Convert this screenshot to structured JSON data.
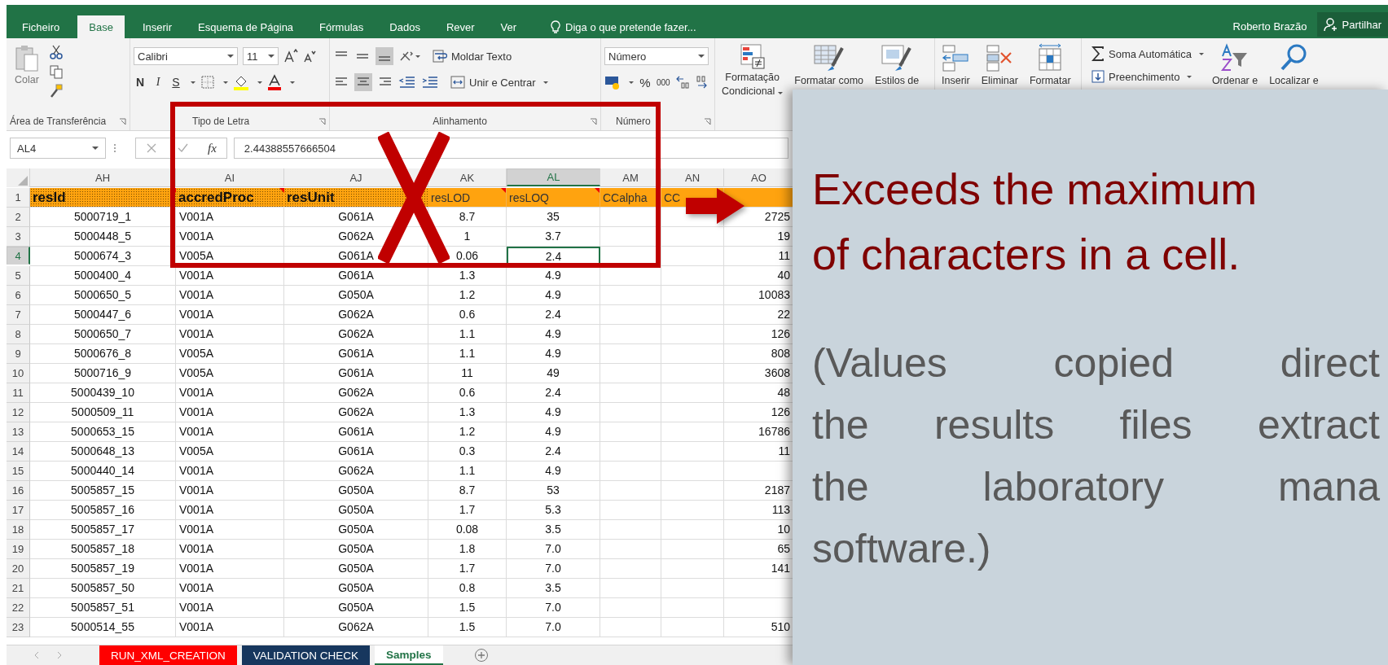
{
  "ribbon_tabs": [
    {
      "label": "Ficheiro",
      "selected": false
    },
    {
      "label": "Base",
      "selected": true
    },
    {
      "label": "Inserir",
      "selected": false
    },
    {
      "label": "Esquema de Página",
      "selected": false
    },
    {
      "label": "Fórmulas",
      "selected": false
    },
    {
      "label": "Dados",
      "selected": false
    },
    {
      "label": "Rever",
      "selected": false
    },
    {
      "label": "Ver",
      "selected": false
    }
  ],
  "tell_me": "Diga o que pretende fazer...",
  "user": "Roberto Brazão",
  "share_button": "Partilhar",
  "clipboard": {
    "paste": "Colar",
    "group": "Área de Transferência"
  },
  "font": {
    "family": "Calibri",
    "size": "11",
    "bold": "N",
    "italic": "I",
    "underline": "S",
    "group": "Tipo de Letra"
  },
  "alignment": {
    "wrap": "Moldar Texto",
    "merge": "Unir e Centrar",
    "group": "Alinhamento"
  },
  "number": {
    "format": "Número",
    "percent": "%",
    "thousands": "000",
    "group": "Número"
  },
  "styles": {
    "conditional": "Formatação",
    "conditional_2": "Condicional",
    "format_table": "Formatar como",
    "cell_styles": "Estilos de"
  },
  "cells_group": {
    "insert": "Inserir",
    "delete": "Eliminar",
    "format": "Formatar"
  },
  "editing": {
    "autosum": "Soma Automática",
    "fill": "Preenchimento",
    "sort": "Ordenar e",
    "find": "Localizar e"
  },
  "formula_bar": {
    "name_box": "AL4",
    "fx": "fx",
    "value": "2.44388557666504"
  },
  "columns": [
    {
      "label": "AH",
      "selected": false
    },
    {
      "label": "AI",
      "selected": false
    },
    {
      "label": "AJ",
      "selected": false
    },
    {
      "label": "AK",
      "selected": false
    },
    {
      "label": "AL",
      "selected": true
    },
    {
      "label": "AM",
      "selected": false
    },
    {
      "label": "AN",
      "selected": false
    },
    {
      "label": "AO",
      "selected": false
    }
  ],
  "header_row": {
    "number": "1",
    "cells": [
      {
        "text": "resId",
        "kind": "key",
        "comment": true
      },
      {
        "text": "accredProc",
        "kind": "key",
        "comment": true
      },
      {
        "text": "resUnit",
        "kind": "key",
        "comment": false
      },
      {
        "text": "resLOD",
        "kind": "plain",
        "comment": true
      },
      {
        "text": "resLOQ",
        "kind": "plain",
        "comment": true
      },
      {
        "text": "CCalpha",
        "kind": "plain",
        "comment": false
      },
      {
        "text": "CC",
        "kind": "plain",
        "comment": false
      },
      {
        "kind": "plain",
        "comment": false
      }
    ]
  },
  "rows": [
    {
      "number": "2",
      "selected": false,
      "cells": [
        "5000719_1",
        "V001A",
        "G061A",
        "8.7",
        "35",
        null,
        null,
        "2725"
      ]
    },
    {
      "number": "3",
      "selected": false,
      "cells": [
        "5000448_5",
        "V001A",
        "G062A",
        "1",
        "3.7",
        null,
        null,
        "19"
      ]
    },
    {
      "number": "4",
      "selected": true,
      "cells": [
        "5000674_3",
        "V005A",
        "G061A",
        "0.06",
        "2.4",
        null,
        null,
        "11"
      ]
    },
    {
      "number": "5",
      "selected": false,
      "cells": [
        "5000400_4",
        "V001A",
        "G061A",
        "1.3",
        "4.9",
        null,
        null,
        "40"
      ]
    },
    {
      "number": "6",
      "selected": false,
      "cells": [
        "5000650_5",
        "V001A",
        "G050A",
        "1.2",
        "4.9",
        null,
        null,
        "10083"
      ]
    },
    {
      "number": "7",
      "selected": false,
      "cells": [
        "5000447_6",
        "V001A",
        "G062A",
        "0.6",
        "2.4",
        null,
        null,
        "22"
      ]
    },
    {
      "number": "8",
      "selected": false,
      "cells": [
        "5000650_7",
        "V001A",
        "G062A",
        "1.1",
        "4.9",
        null,
        null,
        "126"
      ]
    },
    {
      "number": "9",
      "selected": false,
      "cells": [
        "5000676_8",
        "V005A",
        "G061A",
        "1.1",
        "4.9",
        null,
        null,
        "808"
      ]
    },
    {
      "number": "10",
      "selected": false,
      "cells": [
        "5000716_9",
        "V005A",
        "G061A",
        "11",
        "49",
        null,
        null,
        "3608"
      ]
    },
    {
      "number": "11",
      "selected": false,
      "cells": [
        "5000439_10",
        "V001A",
        "G062A",
        "0.6",
        "2.4",
        null,
        null,
        "48"
      ]
    },
    {
      "number": "12",
      "selected": false,
      "cells": [
        "5000509_11",
        "V001A",
        "G062A",
        "1.3",
        "4.9",
        null,
        null,
        "126"
      ]
    },
    {
      "number": "13",
      "selected": false,
      "cells": [
        "5000653_15",
        "V001A",
        "G061A",
        "1.2",
        "4.9",
        null,
        null,
        "16786"
      ]
    },
    {
      "number": "14",
      "selected": false,
      "cells": [
        "5000648_13",
        "V005A",
        "G061A",
        "0.3",
        "2.4",
        null,
        null,
        "11"
      ]
    },
    {
      "number": "15",
      "selected": false,
      "cells": [
        "5000440_14",
        "V001A",
        "G062A",
        "1.1",
        "4.9",
        null,
        null,
        null
      ]
    },
    {
      "number": "16",
      "selected": false,
      "cells": [
        "5005857_15",
        "V001A",
        "G050A",
        "8.7",
        "53",
        null,
        null,
        "2187"
      ]
    },
    {
      "number": "17",
      "selected": false,
      "cells": [
        "5005857_16",
        "V001A",
        "G050A",
        "1.7",
        "5.3",
        null,
        null,
        "113"
      ]
    },
    {
      "number": "18",
      "selected": false,
      "cells": [
        "5005857_17",
        "V001A",
        "G050A",
        "0.08",
        "3.5",
        null,
        null,
        "10"
      ]
    },
    {
      "number": "19",
      "selected": false,
      "cells": [
        "5005857_18",
        "V001A",
        "G050A",
        "1.8",
        "7.0",
        null,
        null,
        "65"
      ]
    },
    {
      "number": "20",
      "selected": false,
      "cells": [
        "5005857_19",
        "V001A",
        "G050A",
        "1.7",
        "7.0",
        null,
        null,
        "141"
      ]
    },
    {
      "number": "21",
      "selected": false,
      "cells": [
        "5005857_50",
        "V001A",
        "G050A",
        "0.8",
        "3.5",
        null,
        null,
        null
      ]
    },
    {
      "number": "22",
      "selected": false,
      "cells": [
        "5005857_51",
        "V001A",
        "G050A",
        "1.5",
        "7.0",
        null,
        null,
        null
      ]
    },
    {
      "number": "23",
      "selected": false,
      "cells": [
        "5000514_55",
        "V001A",
        "G062A",
        "1.5",
        "7.0",
        null,
        null,
        "510"
      ]
    }
  ],
  "sheet_tabs": [
    {
      "label": "RUN_XML_CREATION",
      "selected": false,
      "color": "#ff0000"
    },
    {
      "label": "VALIDATION CHECK",
      "selected": false,
      "color": "#17375e"
    },
    {
      "label": "Samples",
      "selected": true
    }
  ],
  "annotation": {
    "heading": [
      "Exceeds the maximum",
      "of characters in a cell."
    ],
    "paragraph": [
      "(Values copied direct",
      "the results files extract",
      "the laboratory mana",
      "software.)"
    ]
  }
}
